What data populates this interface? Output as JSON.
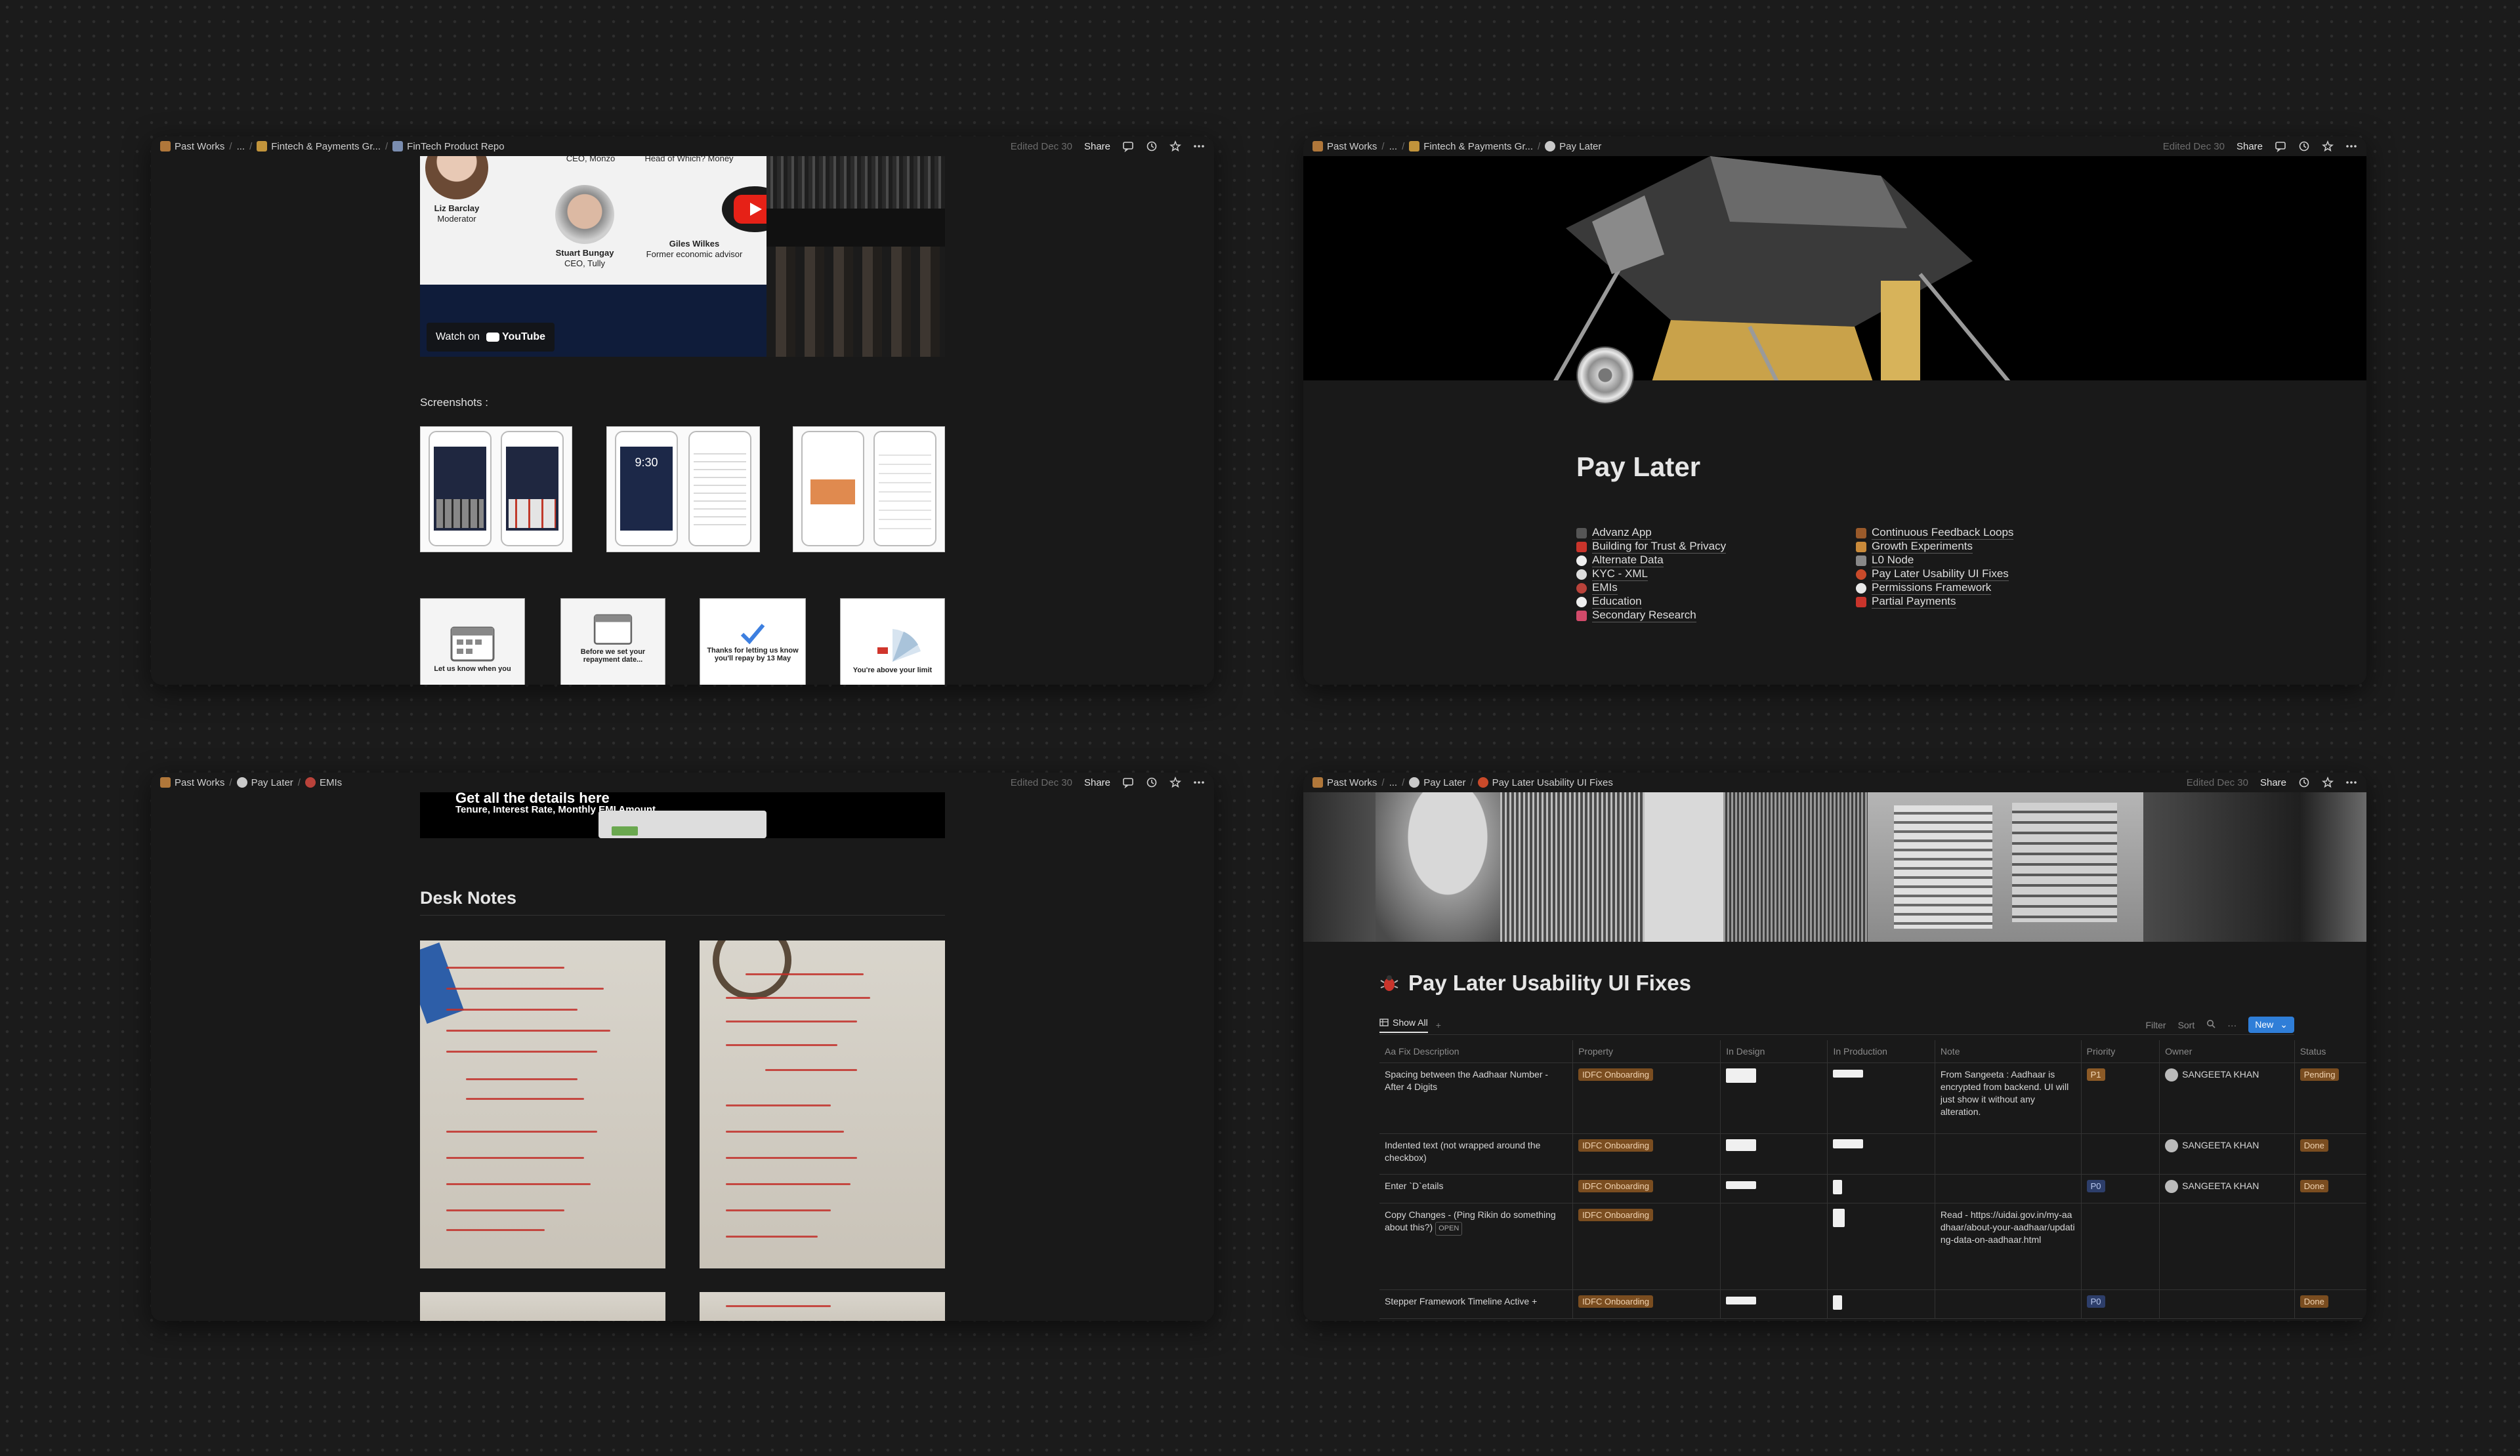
{
  "win1": {
    "breadcrumbs": [
      "Past Works",
      "...",
      "Fintech & Payments Gr...",
      "FinTech Product Repo"
    ],
    "edited": "Edited Dec 30",
    "share": "Share",
    "video": {
      "people": [
        {
          "name": "",
          "role": "CEO, Monzo"
        },
        {
          "name": "",
          "role": "Head of Which? Money"
        },
        {
          "name": "Liz Barclay",
          "role": "Moderator"
        },
        {
          "name": "Stuart Bungay",
          "role": "CEO, Tully"
        },
        {
          "name": "Giles Wilkes",
          "role": "Former economic advisor"
        }
      ],
      "watch_on": "Watch on",
      "youtube": "YouTube"
    },
    "screenshots_label": "Screenshots :",
    "small_shots": [
      "Let us know when you",
      "Before we set your repayment date...",
      "Thanks for letting us know you'll repay by 13 May",
      "You're above your limit"
    ],
    "phone_time": "9:30"
  },
  "win2": {
    "breadcrumbs": [
      "Past Works",
      "...",
      "Fintech & Payments Gr...",
      "Pay Later"
    ],
    "edited": "Edited Dec 30",
    "share": "Share",
    "title": "Pay Later",
    "links_left": [
      "Advanz App",
      "Building for Trust & Privacy",
      "Alternate Data",
      "KYC - XML",
      "EMIs",
      "Education",
      "Secondary Research"
    ],
    "links_right": [
      "Continuous Feedback Loops",
      "Growth Experiments",
      "L0 Node",
      "Pay Later Usability UI Fixes",
      "Permissions Framework",
      "Partial Payments"
    ]
  },
  "win3": {
    "breadcrumbs": [
      "Past Works",
      "Pay Later",
      "EMIs"
    ],
    "edited": "Edited Dec 30",
    "share": "Share",
    "banner_title": "Get all the details here",
    "banner_sub": "Tenure, Interest Rate, Monthly EMI Amount",
    "heading": "Desk Notes"
  },
  "win4": {
    "breadcrumbs": [
      "Past Works",
      "...",
      "Pay Later",
      "Pay Later Usability UI Fixes"
    ],
    "edited": "Edited Dec 30",
    "share": "Share",
    "title": "Pay Later Usability UI Fixes",
    "view_tab": "Show All",
    "filter": "Filter",
    "sort": "Sort",
    "new": "New",
    "columns": [
      "Aa Fix Description",
      "Property",
      "In Design",
      "In Production",
      "Note",
      "Priority",
      "Owner",
      "Status"
    ],
    "rows": [
      {
        "desc": "Spacing between the Aadhaar Number - After 4 Digits",
        "property": "IDFC Onboarding",
        "note": "From Sangeeta : Aadhaar is encrypted from backend. UI will just show it without any alteration.",
        "priority": "P1",
        "owner": "SANGEETA KHAN",
        "status": "Pending"
      },
      {
        "desc": "Indented text (not wrapped around the checkbox)",
        "property": "IDFC Onboarding",
        "note": "",
        "priority": "",
        "owner": "SANGEETA KHAN",
        "status": "Done"
      },
      {
        "desc": "Enter `D`etails",
        "property": "IDFC Onboarding",
        "note": "",
        "priority": "P0",
        "owner": "SANGEETA KHAN",
        "status": "Done"
      },
      {
        "desc": "Copy Changes - (Ping Rikin do something about this?)",
        "open": "OPEN",
        "property": "IDFC Onboarding",
        "note": "Read - https://uidai.gov.in/my-aadhaar/about-your-aadhaar/updating-data-on-aadhaar.html",
        "priority": "",
        "owner": "",
        "status": ""
      },
      {
        "desc": "Stepper Framework Timeline Active +",
        "property": "IDFC Onboarding",
        "note": "",
        "priority": "P0",
        "owner": "",
        "status": "Done"
      }
    ]
  }
}
